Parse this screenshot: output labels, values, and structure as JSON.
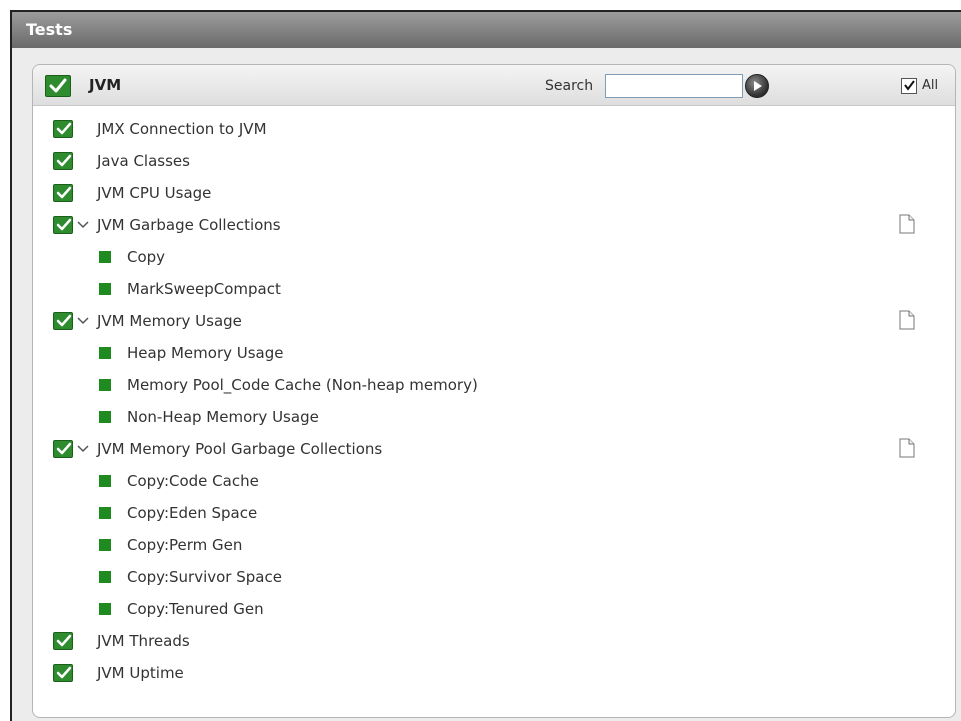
{
  "window": {
    "title": "Tests"
  },
  "panel": {
    "title": "JVM",
    "search_label": "Search",
    "search_value": "",
    "all_label": "All"
  },
  "items": [
    {
      "label": "JMX Connection to JVM"
    },
    {
      "label": "Java Classes"
    },
    {
      "label": "JVM CPU Usage"
    },
    {
      "label": "JVM Garbage Collections",
      "children": [
        "Copy",
        "MarkSweepCompact"
      ]
    },
    {
      "label": "JVM Memory Usage",
      "children": [
        "Heap Memory Usage",
        "Memory Pool_Code Cache (Non-heap memory)",
        "Non-Heap Memory Usage"
      ]
    },
    {
      "label": "JVM Memory Pool Garbage Collections",
      "children": [
        "Copy:Code Cache",
        "Copy:Eden Space",
        "Copy:Perm Gen",
        "Copy:Survivor Space",
        "Copy:Tenured Gen"
      ]
    },
    {
      "label": "JVM Threads"
    },
    {
      "label": "JVM Uptime"
    }
  ],
  "colors": {
    "check_green": "#2e8b2e",
    "child_square": "#1f8a1f",
    "title_bar": "#7a7a7a"
  }
}
